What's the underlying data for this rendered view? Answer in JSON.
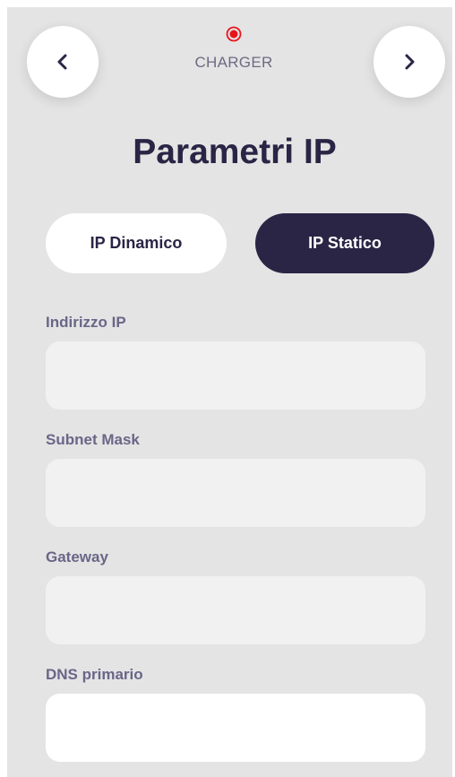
{
  "header": {
    "back_icon": "chevron-left-icon",
    "forward_icon": "chevron-right-icon",
    "status_icon": "record-dot-icon",
    "status_color": "#e8141c",
    "device_label": "CHARGER"
  },
  "page": {
    "title": "Parametri IP"
  },
  "mode_toggle": {
    "dynamic_label": "IP Dinamico",
    "static_label": "IP Statico",
    "selected": "IP Statico"
  },
  "form": {
    "ip_address": {
      "label": "Indirizzo IP",
      "value": ""
    },
    "subnet_mask": {
      "label": "Subnet Mask",
      "value": ""
    },
    "gateway": {
      "label": "Gateway",
      "value": ""
    },
    "dns_primary": {
      "label": "DNS primario",
      "value": ""
    }
  },
  "colors": {
    "background": "#e4e4e4",
    "primary_dark": "#2a2545",
    "label": "#6a6688",
    "input_bg": "#f1f1f1",
    "accent_red": "#e8141c"
  }
}
